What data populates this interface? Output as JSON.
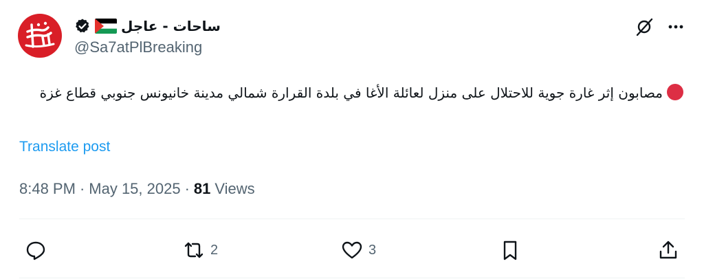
{
  "account": {
    "display_name": "ساحات - عاجل",
    "handle": "@Sa7atPlBreaking",
    "avatar_text": "ساحات",
    "verified": true,
    "flag": "palestine-flag-icon"
  },
  "tweet": {
    "text": "مصابون إثر غارة جوية للاحتلال على منزل لعائلة الأغا في بلدة القرارة شمالي مدينة خانيونس جنوبي قطاع غزة",
    "translate_label": "Translate post",
    "time": "8:48 PM",
    "date": "May 15, 2025",
    "views_count": "81",
    "views_label": "Views",
    "separator": "·"
  },
  "actions": {
    "reply_count": "",
    "retweet_count": "2",
    "like_count": "3",
    "bookmark_count": "",
    "share_count": ""
  },
  "colors": {
    "avatar_bg": "#d91e27",
    "link": "#1d9bf0",
    "muted": "#536471",
    "text": "#0f1419",
    "red_dot": "#dd2e44"
  }
}
